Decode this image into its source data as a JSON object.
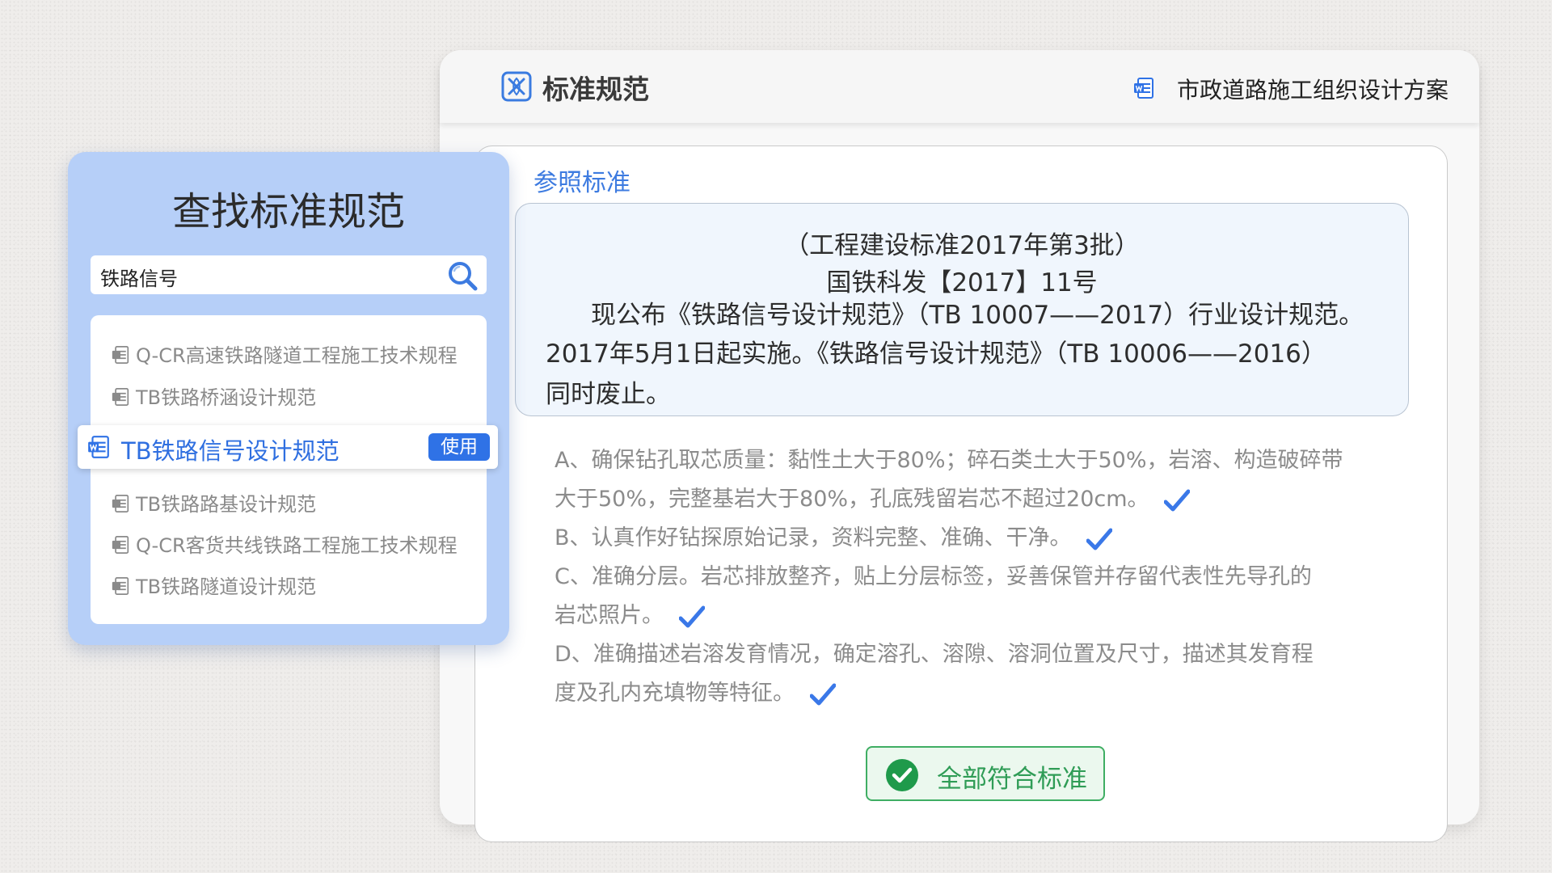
{
  "main": {
    "title": "标准规范",
    "document_title": "市政道路施工组织设计方案",
    "section_label": "参照标准",
    "notice": [
      "（工程建设标准2017年第3批）",
      "国铁科发【2017】11号",
      "现公布《铁路信号设计规范》（TB 10007——2017）行业设计规范。",
      "2017年5月1日起实施。《铁路信号设计规范》（TB 10006——2016）",
      "同时废止。"
    ],
    "checks": [
      "A、确保钻孔取芯质量：黏性土大于80%；碎石类土大于50%，岩溶、构造破碎带",
      "大于50%，完整基岩大于80%，孔底残留岩芯不超过20cm。",
      "B、认真作好钻探原始记录，资料完整、准确、干净。",
      "C、准确分层。岩芯排放整齐，贴上分层标签，妥善保管并存留代表性先导孔的",
      "岩芯照片。",
      "D、准确描述岩溶发育情况，确定溶孔、溶隙、溶洞位置及尺寸，描述其发育程",
      "度及孔内充填物等特征。"
    ],
    "ok_label": "全部符合标准"
  },
  "search": {
    "title": "查找标准规范",
    "query": "铁路信号",
    "results": [
      "Q-CR高速铁路隧道工程施工技术规程",
      "TB铁路桥涵设计规范",
      "TB铁路信号设计规范",
      "TB铁路路基设计规范",
      "Q-CR客货共线铁路工程施工技术规程",
      "TB铁路隧道设计规范"
    ],
    "use_label": "使用"
  },
  "colors": {
    "accent": "#2f72e6",
    "panel": "#b6cff8",
    "success": "#3fae63"
  }
}
